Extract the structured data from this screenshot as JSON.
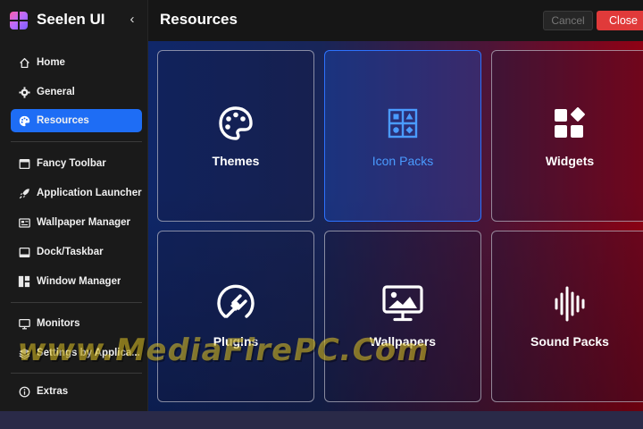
{
  "app": {
    "title": "Seelen UI",
    "collapse_symbol": "‹"
  },
  "header": {
    "title": "Resources",
    "cancel_label": "Cancel",
    "close_label": "Close"
  },
  "sidebar": {
    "items": [
      {
        "label": "Home",
        "icon": "home-icon"
      },
      {
        "label": "General",
        "icon": "gear-icon"
      },
      {
        "label": "Resources",
        "icon": "palette-icon",
        "active": true
      },
      {
        "label": "Fancy Toolbar",
        "icon": "toolbar-icon"
      },
      {
        "label": "Application Launcher",
        "icon": "rocket-icon"
      },
      {
        "label": "Wallpaper Manager",
        "icon": "wallpaper-icon"
      },
      {
        "label": "Dock/Taskbar",
        "icon": "dock-icon"
      },
      {
        "label": "Window Manager",
        "icon": "window-manager-icon"
      },
      {
        "label": "Monitors",
        "icon": "monitor-icon"
      },
      {
        "label": "Settings by Applica...",
        "icon": "layers-icon"
      },
      {
        "label": "Extras",
        "icon": "info-icon"
      }
    ]
  },
  "cards": [
    {
      "label": "Themes",
      "icon": "palette-icon"
    },
    {
      "label": "Icon Packs",
      "icon": "icon-pack-icon",
      "selected": true
    },
    {
      "label": "Widgets",
      "icon": "widgets-icon"
    },
    {
      "label": "Plugins",
      "icon": "plug-icon"
    },
    {
      "label": "Wallpapers",
      "icon": "wallpaper-icon"
    },
    {
      "label": "Sound Packs",
      "icon": "sound-wave-icon"
    }
  ],
  "watermark": "www.MediaFirePC.Com",
  "colors": {
    "accent": "#1e6df5",
    "close": "#e03a3a",
    "selected_label": "#4a9bff"
  }
}
